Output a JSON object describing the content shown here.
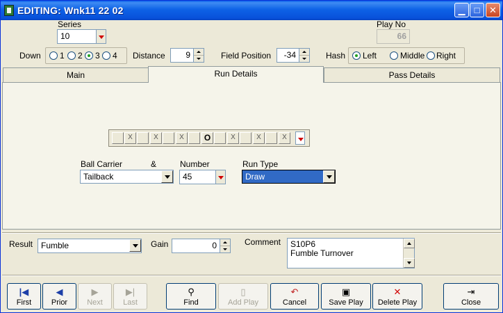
{
  "window": {
    "title": "EDITING: Wnk11 22 02"
  },
  "series": {
    "label": "Series",
    "value": "10"
  },
  "play_no": {
    "label": "Play No",
    "value": "66"
  },
  "down": {
    "label": "Down",
    "options": [
      "1",
      "2",
      "3",
      "4"
    ],
    "selected": "3"
  },
  "distance": {
    "label": "Distance",
    "value": "9"
  },
  "field_position": {
    "label": "Field Position",
    "value": "-34"
  },
  "hash": {
    "label": "Hash",
    "options": [
      "Left",
      "Middle",
      "Right"
    ],
    "selected": "Left"
  },
  "tabs": [
    {
      "label": "Main",
      "active": false
    },
    {
      "label": "Run Details",
      "active": true
    },
    {
      "label": "Pass Details",
      "active": false
    }
  ],
  "formation": {
    "cells": [
      "",
      "X",
      "",
      "X",
      "",
      "X",
      "",
      "O",
      "",
      "X",
      "",
      "X",
      "",
      "X"
    ]
  },
  "run": {
    "ball_carrier_label": "Ball Carrier",
    "amp_label": "&",
    "ball_carrier_value": "Tailback",
    "number_label": "Number",
    "number_value": "45",
    "run_type_label": "Run Type",
    "run_type_value": "Draw"
  },
  "result": {
    "label": "Result",
    "value": "Fumble"
  },
  "gain": {
    "label": "Gain",
    "value": "0"
  },
  "comment": {
    "label": "Comment",
    "line1": "S10P6",
    "line2": "Fumble Turnover"
  },
  "buttons": {
    "first": "First",
    "prior": "Prior",
    "next": "Next",
    "last": "Last",
    "find": "Find",
    "add_play": "Add Play",
    "cancel": "Cancel",
    "save_play": "Save Play",
    "delete_play": "Delete Play",
    "close": "Close"
  },
  "colors": {
    "titlebar": "#0a5dea",
    "selection": "#316ac5",
    "dropdown_arrow": "#d00000"
  }
}
